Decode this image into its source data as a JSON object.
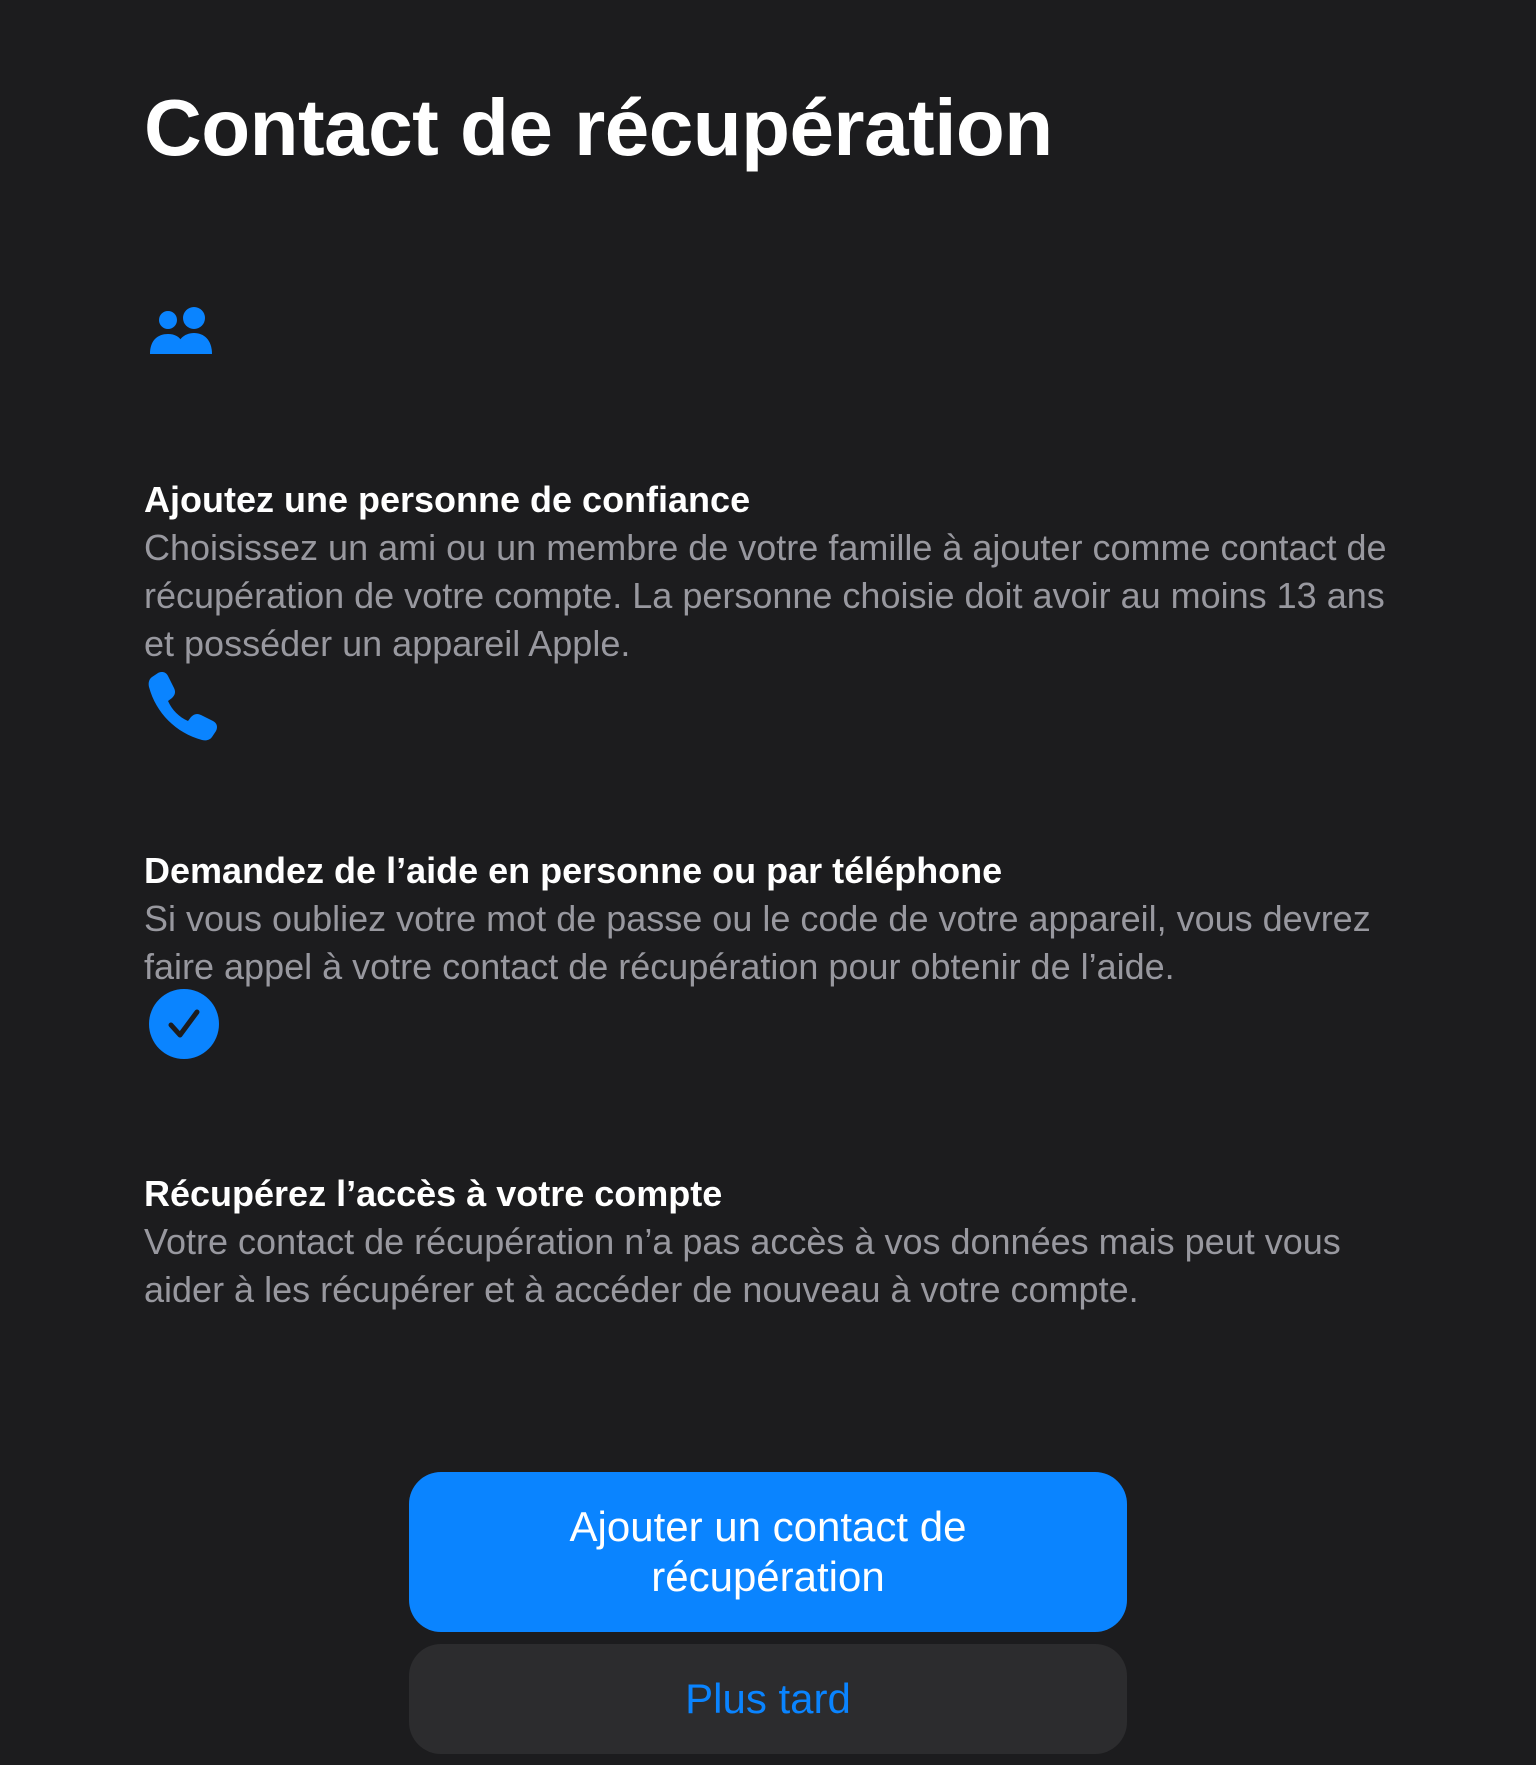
{
  "page": {
    "title": "Contact de récupération"
  },
  "features": [
    {
      "icon": "people-icon",
      "heading": "Ajoutez une personne de confiance",
      "text": "Choisissez un ami ou un membre de votre famille à ajouter comme contact de récupération de votre compte. La personne choisie doit avoir au moins 13 ans et posséder un appareil Apple."
    },
    {
      "icon": "phone-icon",
      "heading": "Demandez de l’aide en personne ou par téléphone",
      "text": "Si vous oubliez votre mot de passe ou le code de votre appareil, vous devrez faire appel à votre contact de récupération pour obtenir de l’aide."
    },
    {
      "icon": "checkmark-circle-icon",
      "heading": "Récupérez l’accès à votre compte",
      "text": "Votre contact de récupération n’a pas accès à vos données mais peut vous aider à les récupérer et à accéder de nouveau à votre compte."
    }
  ],
  "actions": {
    "primary_label": "Ajouter un contact de récupération",
    "secondary_label": "Plus tard"
  },
  "colors": {
    "background": "#1c1c1e",
    "accent": "#0a84ff",
    "secondary_text": "#98989f",
    "secondary_button": "#2c2c2e"
  }
}
